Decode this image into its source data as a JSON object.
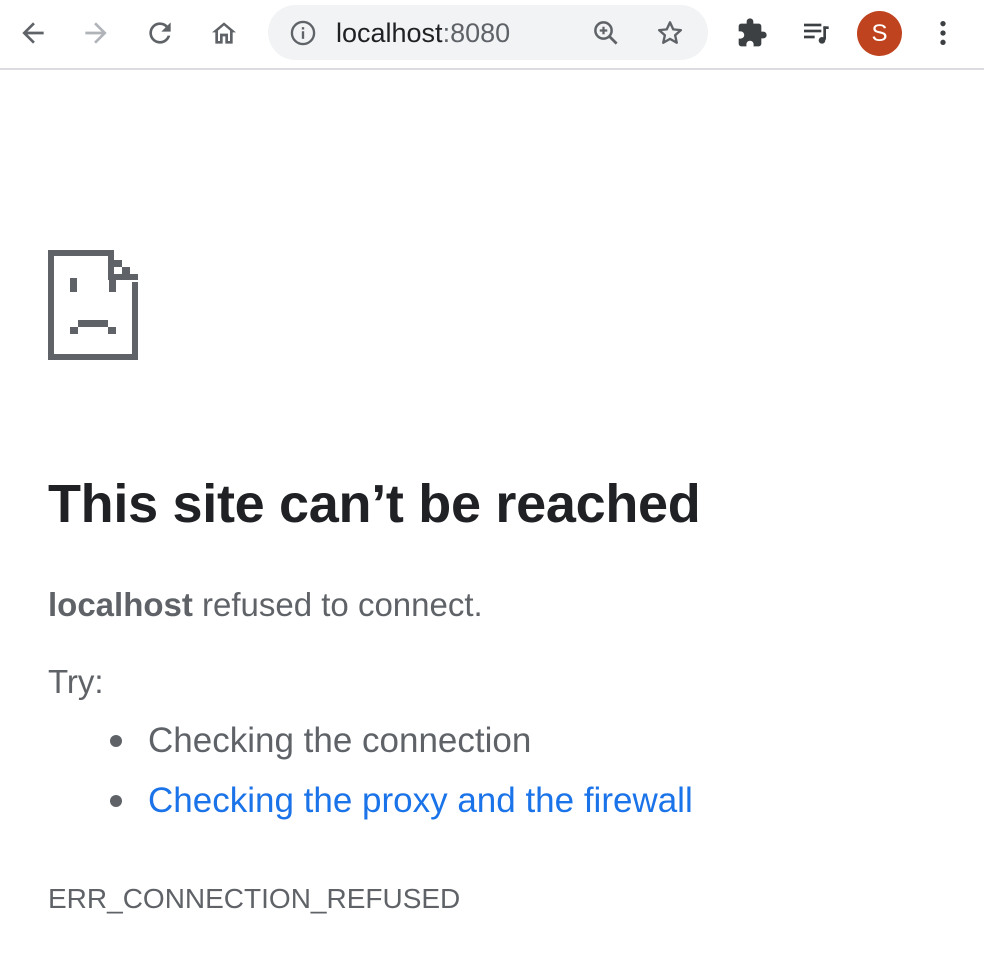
{
  "toolbar": {
    "back_icon": "arrow-left-icon",
    "forward_icon": "arrow-right-icon",
    "reload_icon": "reload-icon",
    "home_icon": "home-icon",
    "omnibox": {
      "info_icon": "info-icon",
      "host": "localhost",
      "port": ":8080",
      "zoom_icon": "zoom-in-icon",
      "bookmark_icon": "star-icon"
    },
    "extensions_icon": "puzzle-icon",
    "media_icon": "media-queue-icon",
    "profile_initial": "S",
    "profile_color": "#c0431f",
    "menu_icon": "kebab-menu-icon"
  },
  "error_page": {
    "icon": "sad-document-icon",
    "title": "This site can’t be reached",
    "host": "localhost",
    "message_rest": " refused to connect.",
    "try_label": "Try:",
    "suggestions": [
      {
        "text": "Checking the connection",
        "link": false
      },
      {
        "text": "Checking the proxy and the firewall",
        "link": true
      }
    ],
    "error_code": "ERR_CONNECTION_REFUSED",
    "link_color": "#1a73e8",
    "text_color": "#5f6368",
    "heading_color": "#202124"
  }
}
